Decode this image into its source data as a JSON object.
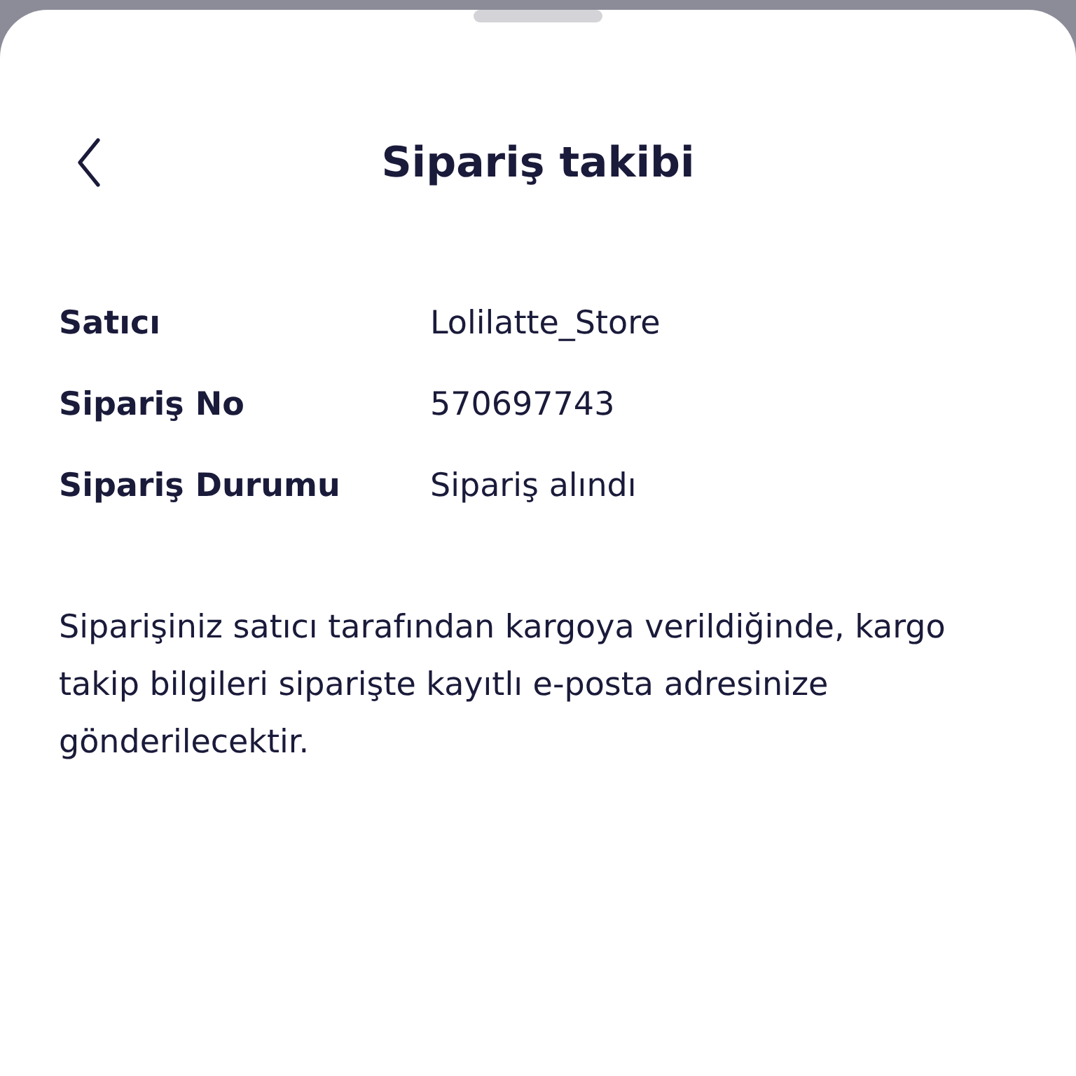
{
  "header": {
    "title": "Sipariş takibi"
  },
  "details": [
    {
      "label": "Satıcı",
      "value": "Lolilatte_Store"
    },
    {
      "label": "Sipariş No",
      "value": "570697743"
    },
    {
      "label": "Sipariş Durumu",
      "value": "Sipariş alındı"
    }
  ],
  "note": "Siparişiniz satıcı tarafından kargoya verildiğinde, kargo takip bilgileri siparişte kayıtlı e-posta adresinize gönderilecektir."
}
